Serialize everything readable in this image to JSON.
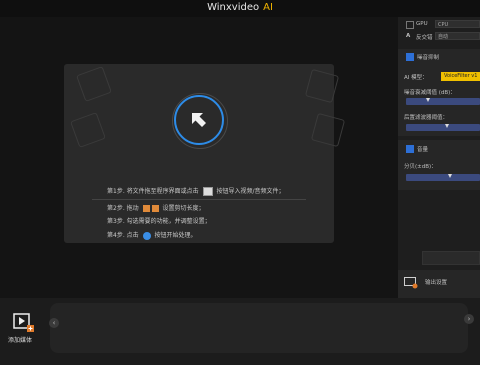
{
  "app": {
    "title": "Winxvideo",
    "title_ai": "AI"
  },
  "preview": {
    "steps": [
      {
        "pre": "第1步. 将文件拖至程序界面或点击",
        "post": "按钮导入视频/音频文件；"
      },
      {
        "pre": "第2步. 拖动",
        "post": "设置剪切长度；"
      },
      {
        "pre": "第3步. 勾选需要的功能，并调整设置；",
        "post": ""
      },
      {
        "pre": "第4步. 点击",
        "post": "按钮开始处理。"
      }
    ]
  },
  "right_panel": {
    "gpu_label": "GPU",
    "cpu_label": "CPU",
    "antialias_label": "反交错",
    "auto_label": "自动",
    "denoise_section_label": "噪音抑制",
    "ai_model_label": "AI 模型：",
    "ai_model_value": "VoiceFilter v1",
    "noise_threshold_label": "噪音衰减阈值 (dB)：",
    "noise_threshold_level": 0.3,
    "post_filter_label": "后置滤波器阈值：",
    "post_filter_level": 0.55,
    "volume_section_label": "音量",
    "gain_label": "分贝(±dB)：",
    "gain_level": 0.6,
    "export_label": "输出设置"
  },
  "bottom": {
    "add_media_label": "添加媒体",
    "prev_icon": "‹",
    "next_icon": "›"
  }
}
